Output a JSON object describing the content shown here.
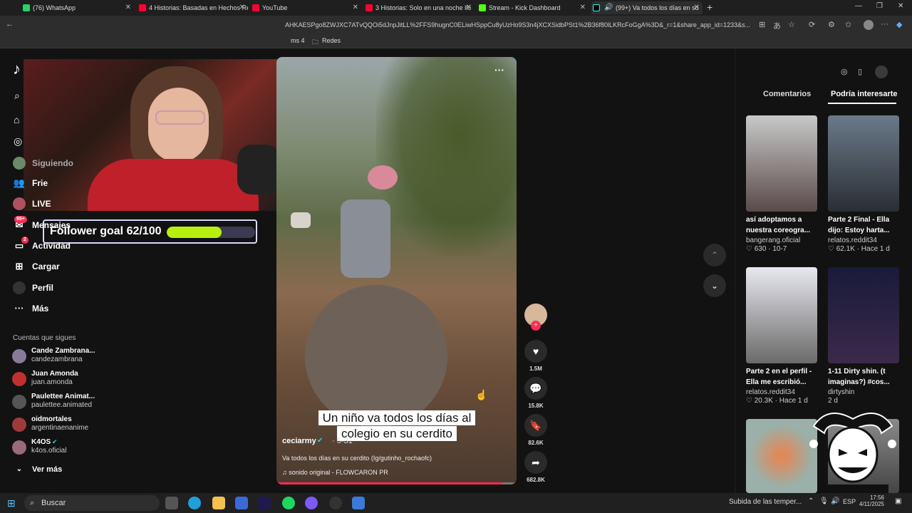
{
  "browser": {
    "tabs": [
      {
        "title": "(76) WhatsApp",
        "color": "#25d366"
      },
      {
        "title": "4 Historias: Basadas en Hechos Re",
        "color": "#ff0033"
      },
      {
        "title": "YouTube",
        "color": "#ff0033"
      },
      {
        "title": "3 Historias: Solo en una noche llu",
        "color": "#ff0033"
      },
      {
        "title": "Stream - Kick Dashboard",
        "color": "#53fc18"
      },
      {
        "title": "(99+) Va todos los días en su",
        "color": "#000000"
      }
    ],
    "url": "AHKAESPgo8ZWJXC7ATvQQOi5dJnpJitLL%2FFS9hugnC0ELiwHSppCu8yUzHo9S3n4jXCXSidbPSt1%2B36f80lLKRcFoGgA%3D&_r=1&share_app_id=1233&s...",
    "bookmarks": [
      "ms 4",
      "Redes"
    ]
  },
  "overlay": {
    "follower_goal_label": "Follower goal 62/100",
    "follower_goal_fraction": 0.62
  },
  "sidebar": {
    "items": [
      {
        "label": "Siguiendo",
        "icon": "following-icon"
      },
      {
        "label": "Frie",
        "icon": "friends-icon"
      },
      {
        "label": "LIVE",
        "icon": "live-icon"
      },
      {
        "label": "Mensajes",
        "icon": "messages-icon",
        "badge": "99+"
      },
      {
        "label": "Actividad",
        "icon": "activity-icon",
        "badge": "2"
      },
      {
        "label": "Cargar",
        "icon": "upload-icon"
      },
      {
        "label": "Perfil",
        "icon": "profile-icon"
      },
      {
        "label": "Más",
        "icon": "more-icon"
      }
    ],
    "follows_title": "Cuentas que sigues",
    "accounts": [
      {
        "name": "Cande Zambrana...",
        "handle": "candezambrana"
      },
      {
        "name": "Juan Amonda",
        "handle": "juan.amonda"
      },
      {
        "name": "Paulettee Animat...",
        "handle": "paulettee.animated"
      },
      {
        "name": "oidmortales",
        "handle": "argentinaenanime"
      },
      {
        "name": "K4OS",
        "handle": "k4os.oficial"
      }
    ],
    "see_more": "Ver más"
  },
  "video": {
    "caption": "Un niño va todos los días al colegio en su cerdito",
    "author": "ceciarmy",
    "date": "· 5-31",
    "description": "Va todos los días en su cerdito (Ig/gutinho_rochaofc)",
    "sound": "♫  sonido original - FLOWCARON PR",
    "progress_fraction": 0.94,
    "more_menu": "···"
  },
  "actions": {
    "likes": "1.5M",
    "comments": "15.8K",
    "saves": "82.6K",
    "shares": "682.8K"
  },
  "right_panel": {
    "tabs": [
      "Comentarios",
      "Podría interesarte"
    ],
    "cards": [
      {
        "title": "así adoptamos a nuestra coreogra...",
        "user": "bangerang.oficial",
        "likes": "630",
        "date": "10-7"
      },
      {
        "title": "Parte 2 Final - Ella dijo: Estoy harta...",
        "user": "relatos.reddit34",
        "likes": "62.1K",
        "date": "Hace 1 d"
      },
      {
        "title": "Parte 2 en el perfil - Ella me escribió...",
        "user": "relatos.reddit34",
        "likes": "20.3K",
        "date": "Hace 1 d"
      },
      {
        "title": "1-11 Dirty shin. (t imaginas?) #cos...",
        "user": "dirtyshin",
        "likes": "",
        "date": "2 d"
      }
    ]
  },
  "taskbar": {
    "search_placeholder": "Buscar",
    "weather": "Subida de las temper...",
    "lang": "ESP",
    "time": "17:56",
    "date": "4/11/2025"
  }
}
